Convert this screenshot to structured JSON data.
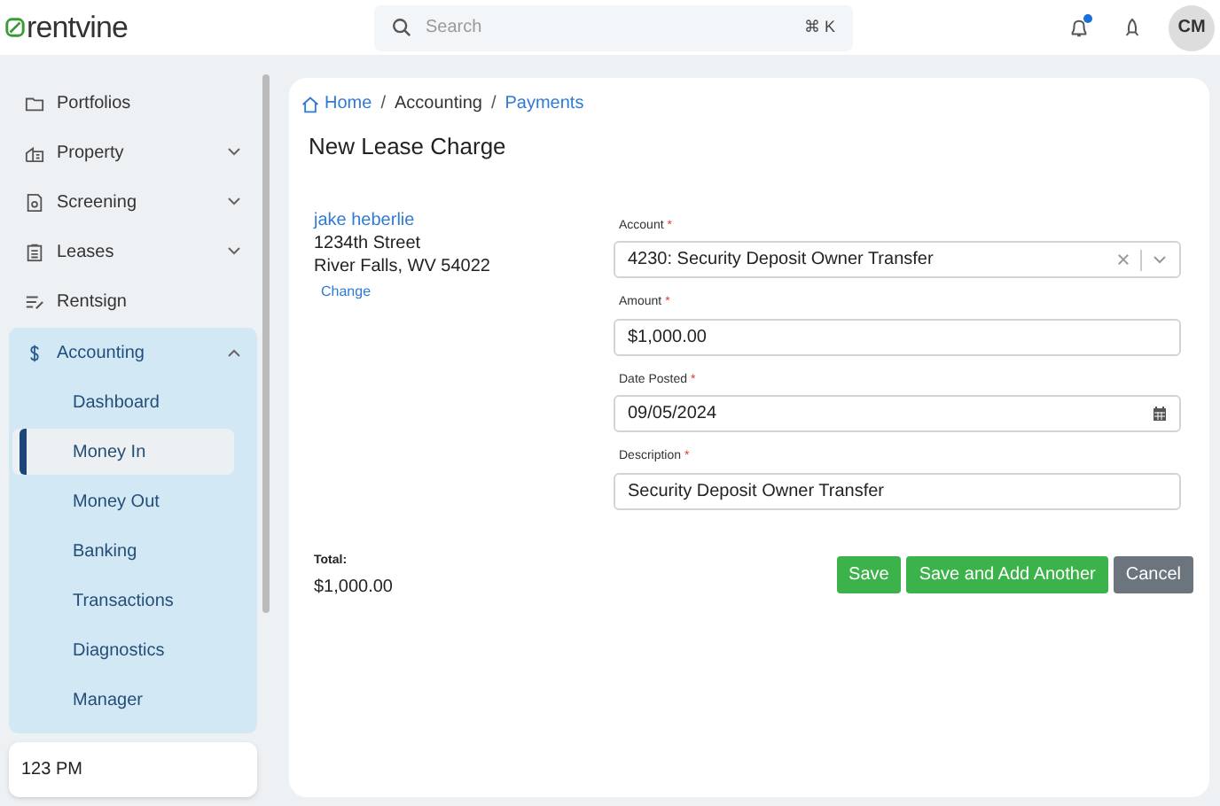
{
  "header": {
    "logo": "rentvine",
    "search": {
      "placeholder": "Search",
      "shortcut": "⌘ K"
    },
    "notifications": {
      "unread": true
    },
    "avatar": "CM"
  },
  "sidebar": {
    "items": [
      {
        "label": "Portfolios",
        "kind": "link"
      },
      {
        "label": "Property",
        "kind": "group",
        "expanded": false
      },
      {
        "label": "Screening",
        "kind": "group",
        "expanded": false
      },
      {
        "label": "Leases",
        "kind": "group",
        "expanded": false
      },
      {
        "label": "Rentsign",
        "kind": "link"
      },
      {
        "label": "Accounting",
        "kind": "group",
        "expanded": true,
        "children": [
          {
            "label": "Dashboard",
            "selected": false
          },
          {
            "label": "Money In",
            "selected": true
          },
          {
            "label": "Money Out",
            "selected": false
          },
          {
            "label": "Banking",
            "selected": false
          },
          {
            "label": "Transactions",
            "selected": false
          },
          {
            "label": "Diagnostics",
            "selected": false
          },
          {
            "label": "Manager",
            "selected": false
          }
        ]
      }
    ],
    "footer": "123 PM"
  },
  "breadcrumbs": {
    "separator": "/",
    "items": [
      {
        "label": "Home",
        "kind": "link"
      },
      {
        "label": "Accounting",
        "kind": "text"
      },
      {
        "label": "Payments",
        "kind": "link"
      }
    ]
  },
  "required_marker": "*",
  "page_title": "New Lease Charge",
  "tenant": {
    "name": "jake heberlie",
    "address": [
      "1234th Street",
      "River Falls, WV 54022"
    ],
    "change_link": "Change"
  },
  "fields": [
    {
      "label": "Account",
      "required": true,
      "kind": "select",
      "value": "4230: Security Deposit Owner Transfer"
    },
    {
      "label": "Amount",
      "required": true,
      "kind": "text",
      "value": "$1,000.00"
    },
    {
      "label": "Date Posted",
      "required": true,
      "kind": "date",
      "value": "09/05/2024"
    },
    {
      "label": "Description",
      "required": true,
      "kind": "text",
      "value": "Security Deposit Owner Transfer"
    }
  ],
  "total": {
    "label": "Total:",
    "value": "$1,000.00"
  },
  "buttons": [
    {
      "label": "Save",
      "kind": "primary"
    },
    {
      "label": "Save and Add Another",
      "kind": "primary"
    },
    {
      "label": "Cancel",
      "kind": "secondary"
    }
  ]
}
